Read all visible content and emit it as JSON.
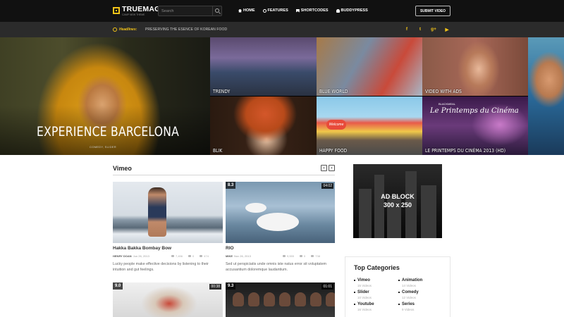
{
  "brand": {
    "name": "TRUEMAG",
    "tagline": "CAMP NEW THEME",
    "accent": "#f5c518"
  },
  "search": {
    "placeholder": "Search",
    "icon": "search-icon"
  },
  "nav": [
    {
      "label": "HOME",
      "icon": "home-icon"
    },
    {
      "label": "FEATURES",
      "icon": "star-icon"
    },
    {
      "label": "SHORTCODES",
      "icon": "bookmark-icon"
    },
    {
      "label": "BUDDYPRESS",
      "icon": "user-icon"
    }
  ],
  "submit_label": "SUBMIT VIDEO",
  "headlines": {
    "label": "Headlines:",
    "text": "PRESERVING THE ESENCE OF KOREAN FOOD"
  },
  "social": [
    {
      "glyph": "f",
      "icon": "facebook-icon"
    },
    {
      "glyph": "t",
      "icon": "twitter-icon"
    },
    {
      "glyph": "g+",
      "icon": "google-plus-icon"
    },
    {
      "glyph": "▶",
      "icon": "youtube-icon"
    }
  ],
  "hero": {
    "title": "EXPERIENCE BARCELONA",
    "subtitle": "COMEDY, SLIDER",
    "tiles": [
      {
        "caption": "TRENDY"
      },
      {
        "caption": "BLUE WORLD"
      },
      {
        "caption": "VIDEO WITH ADS"
      },
      {
        "caption": ""
      },
      {
        "caption": "BLIK"
      },
      {
        "caption": "HAPPY FOOD",
        "sign": "Welcome"
      },
      {
        "caption": "LE PRINTEMPS DU CINÉMA 2013 (HD)",
        "brand": "BLACKMEAL",
        "script": "Le Printemps du Cinéma"
      }
    ]
  },
  "section": {
    "title": "Vimeo",
    "prev": "‹",
    "next": "›"
  },
  "cards": [
    {
      "title": "Hakka Bakka Bombay Bow",
      "author": "HENRY DOAN",
      "date": "Jun 26, 2013",
      "views": "7,456",
      "comments": "0",
      "likes": "474",
      "desc": "Lucky people make effective decisions by listening to their intuition and gut feelings."
    },
    {
      "badge": "8.3",
      "duration": "04:02",
      "title": "RIO",
      "author": "MIKE",
      "date": "Nov 26, 2013",
      "views": "9,555",
      "comments": "0",
      "likes": "738",
      "desc": "Sed ut perspiciatis unde omnis iste natus error sit voluptatem accusantium doloremque laudantium."
    },
    {
      "badge": "9.0",
      "duration": "00:38"
    },
    {
      "badge": "9.3",
      "duration": "01:01"
    }
  ],
  "ad": {
    "line1": "AD BLOCK",
    "line2": "300 x 250"
  },
  "categories": {
    "title": "Top Categories",
    "items": [
      {
        "name": "Vimeo",
        "count": "15 Videos"
      },
      {
        "name": "Animation",
        "count": "14 Videos"
      },
      {
        "name": "Slider",
        "count": "10 Videos"
      },
      {
        "name": "Comedy",
        "count": "12 Videos"
      },
      {
        "name": "Youtube",
        "count": "16 Videos"
      },
      {
        "name": "Series",
        "count": "9 Videos"
      }
    ]
  }
}
